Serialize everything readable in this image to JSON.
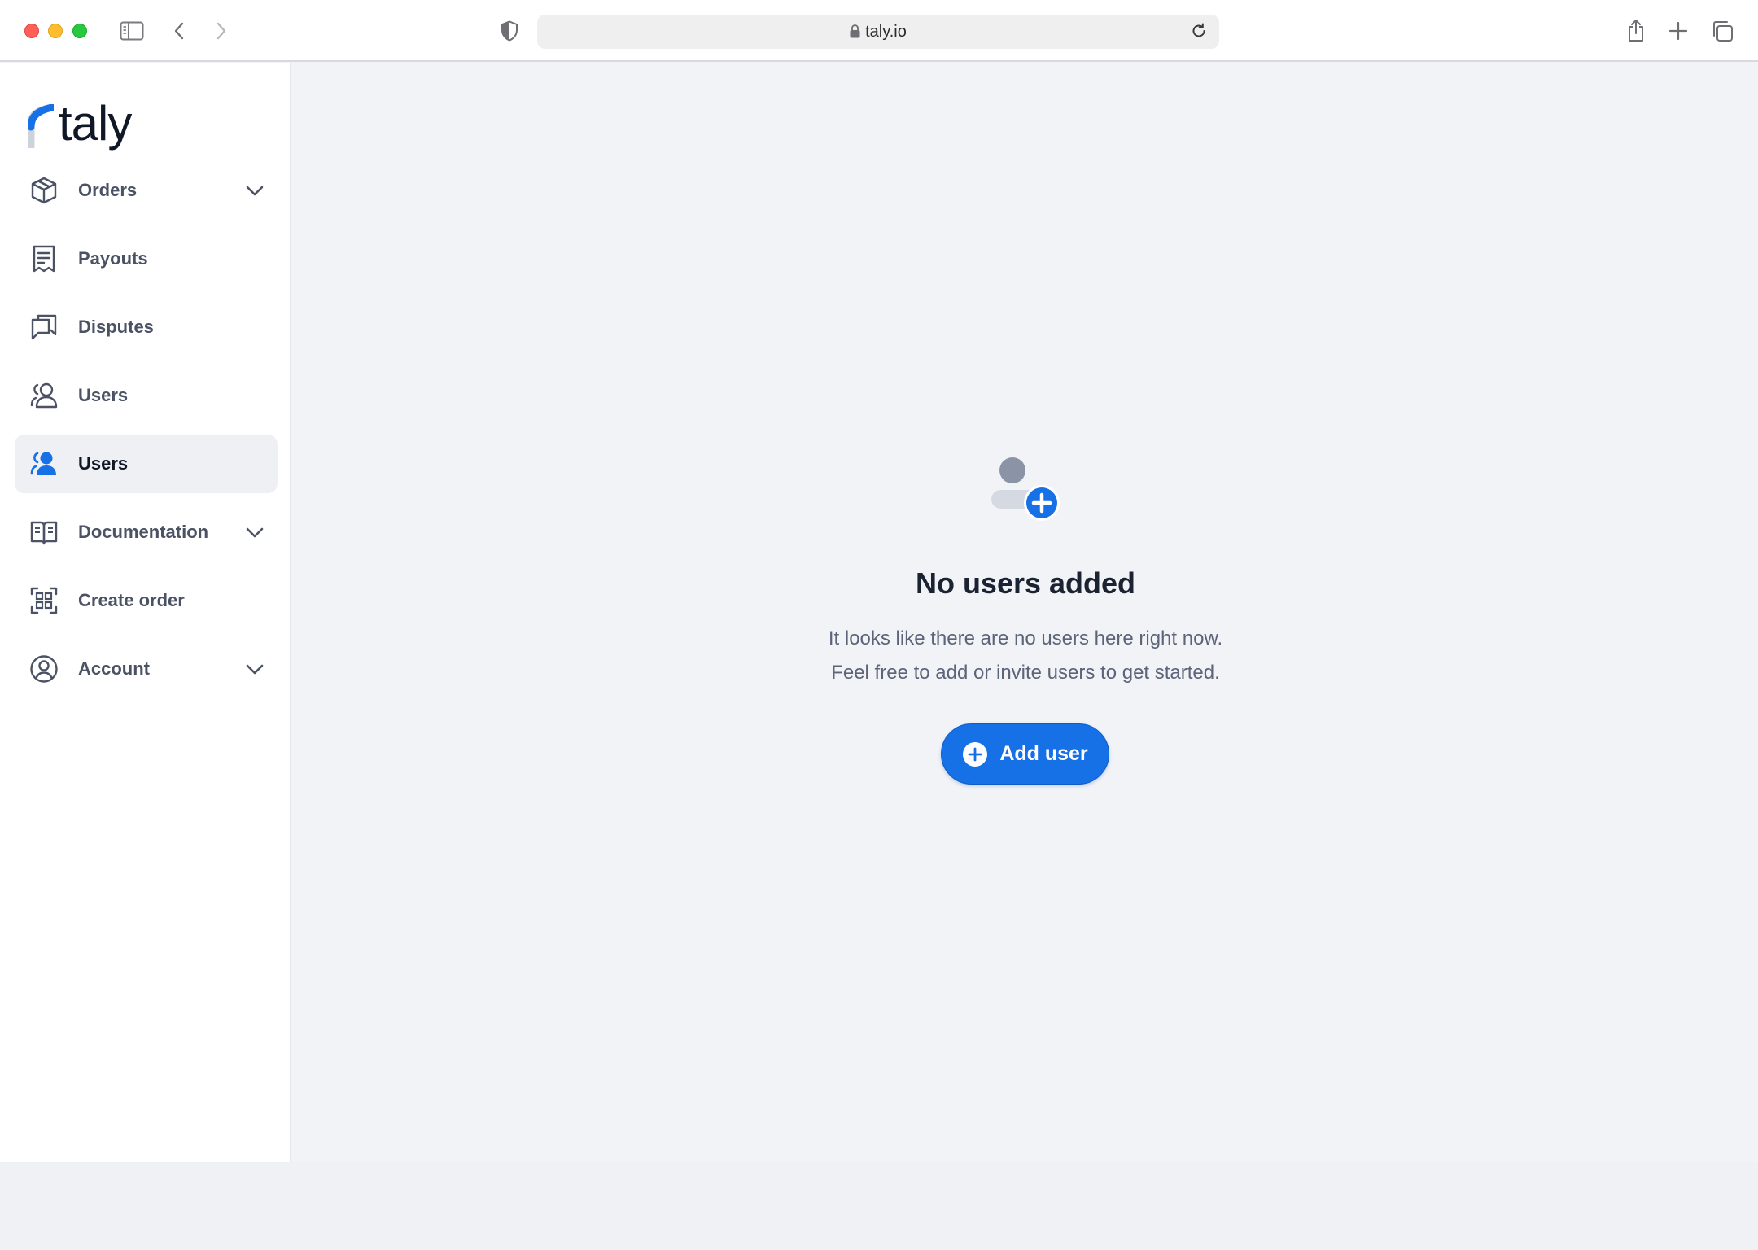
{
  "browser": {
    "url": "taly.io"
  },
  "sidebar": {
    "logo_text": "taly",
    "items": [
      {
        "label": "Orders",
        "icon": "box-icon",
        "has_submenu": true,
        "active": false
      },
      {
        "label": "Payouts",
        "icon": "receipt-icon",
        "has_submenu": false,
        "active": false
      },
      {
        "label": "Disputes",
        "icon": "chat-bubbles-icon",
        "has_submenu": false,
        "active": false
      },
      {
        "label": "Users",
        "icon": "users-outline-icon",
        "has_submenu": false,
        "active": false
      },
      {
        "label": "Users",
        "icon": "users-filled-icon",
        "has_submenu": false,
        "active": true
      },
      {
        "label": "Documentation",
        "icon": "book-icon",
        "has_submenu": true,
        "active": false
      },
      {
        "label": "Create order",
        "icon": "qr-code-icon",
        "has_submenu": false,
        "active": false
      },
      {
        "label": "Account",
        "icon": "user-circle-icon",
        "has_submenu": true,
        "active": false
      }
    ]
  },
  "empty_state": {
    "icon": "user-add-icon",
    "title": "No users added",
    "line1": "It looks like there are no users here right now.",
    "line2": "Feel free to add or invite users to get started.",
    "button_label": "Add user"
  },
  "colors": {
    "accent": "#1671e6",
    "sidebar_bg": "#ffffff",
    "main_bg": "#f2f3f7",
    "active_item_bg": "#eef0f4"
  }
}
